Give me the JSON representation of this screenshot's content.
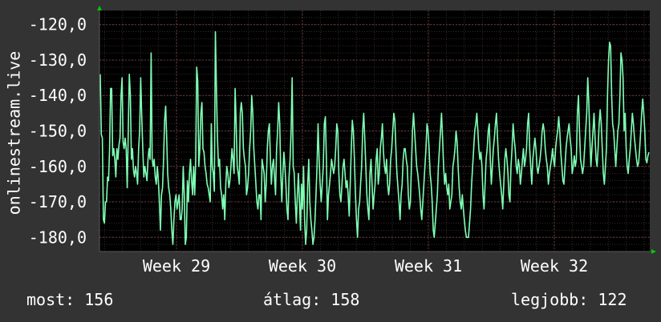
{
  "chart_data": {
    "type": "line",
    "ylabel": "onlinestream.live",
    "ylim": [
      -184,
      -116
    ],
    "y_ticks": [
      -120,
      -130,
      -140,
      -150,
      -160,
      -170,
      -180
    ],
    "y_tick_labels": [
      "-120,0",
      "-130,0",
      "-140,0",
      "-150,0",
      "-160,0",
      "-170,0",
      "-180,0"
    ],
    "x_tick_labels": [
      "Week 29",
      "Week 30",
      "Week 31",
      "Week 32"
    ],
    "grid": true,
    "series": [
      {
        "color": "#7fffb4",
        "values": [
          -134,
          -151,
          -152,
          -175,
          -176,
          -170,
          -170,
          -163,
          -164,
          -155,
          -138,
          -138,
          -157,
          -155,
          -158,
          -163,
          -155,
          -158,
          -154,
          -152,
          -140,
          -135,
          -153,
          -155,
          -152,
          -155,
          -166,
          -150,
          -134,
          -140,
          -158,
          -155,
          -161,
          -163,
          -160,
          -162,
          -165,
          -155,
          -150,
          -135,
          -146,
          -155,
          -163,
          -160,
          -162,
          -164,
          -158,
          -155,
          -158,
          -128,
          -158,
          -160,
          -158,
          -163,
          -165,
          -160,
          -164,
          -170,
          -178,
          -168,
          -166,
          -158,
          -147,
          -143,
          -152,
          -162,
          -166,
          -168,
          -172,
          -178,
          -182,
          -175,
          -170,
          -168,
          -172,
          -170,
          -168,
          -175,
          -175,
          -172,
          -160,
          -168,
          -182,
          -180,
          -164,
          -170,
          -162,
          -158,
          -164,
          -168,
          -160,
          -168,
          -158,
          -132,
          -136,
          -160,
          -155,
          -145,
          -142,
          -155,
          -156,
          -160,
          -162,
          -165,
          -166,
          -168,
          -170,
          -148,
          -160,
          -162,
          -167,
          -122,
          -138,
          -152,
          -160,
          -158,
          -166,
          -168,
          -172,
          -168,
          -175,
          -165,
          -160,
          -162,
          -166,
          -164,
          -160,
          -155,
          -158,
          -162,
          -138,
          -148,
          -160,
          -162,
          -165,
          -145,
          -142,
          -145,
          -155,
          -158,
          -160,
          -168,
          -166,
          -162,
          -155,
          -150,
          -140,
          -145,
          -155,
          -160,
          -165,
          -170,
          -172,
          -168,
          -168,
          -175,
          -158,
          -160,
          -162,
          -170,
          -165,
          -155,
          -150,
          -148,
          -158,
          -165,
          -160,
          -158,
          -163,
          -168,
          -155,
          -150,
          -142,
          -148,
          -162,
          -170,
          -162,
          -156,
          -160,
          -165,
          -172,
          -175,
          -163,
          -158,
          -150,
          -135,
          -160,
          -162,
          -170,
          -176,
          -168,
          -162,
          -170,
          -178,
          -165,
          -172,
          -160,
          -175,
          -182,
          -178,
          -165,
          -158,
          -170,
          -175,
          -178,
          -182,
          -180,
          -175,
          -168,
          -160,
          -148,
          -158,
          -165,
          -170,
          -165,
          -160,
          -148,
          -146,
          -158,
          -175,
          -168,
          -165,
          -162,
          -158,
          -160,
          -162,
          -160,
          -155,
          -148,
          -150,
          -162,
          -168,
          -170,
          -165,
          -160,
          -158,
          -162,
          -166,
          -164,
          -168,
          -174,
          -165,
          -155,
          -147,
          -150,
          -158,
          -168,
          -175,
          -180,
          -172,
          -170,
          -165,
          -160,
          -150,
          -145,
          -152,
          -160,
          -168,
          -172,
          -175,
          -162,
          -158,
          -165,
          -172,
          -168,
          -165,
          -158,
          -155,
          -165,
          -162,
          -155,
          -152,
          -148,
          -156,
          -160,
          -162,
          -158,
          -165,
          -168,
          -165,
          -158,
          -155,
          -150,
          -145,
          -147,
          -155,
          -162,
          -166,
          -170,
          -175,
          -168,
          -165,
          -158,
          -155,
          -155,
          -158,
          -160,
          -168,
          -172,
          -170,
          -160,
          -150,
          -145,
          -150,
          -155,
          -160,
          -162,
          -165,
          -168,
          -172,
          -175,
          -170,
          -165,
          -160,
          -155,
          -148,
          -150,
          -155,
          -162,
          -165,
          -170,
          -178,
          -180,
          -176,
          -172,
          -168,
          -160,
          -155,
          -150,
          -145,
          -152,
          -160,
          -165,
          -162,
          -166,
          -168,
          -165,
          -172,
          -170,
          -168,
          -160,
          -158,
          -155,
          -150,
          -153,
          -160,
          -166,
          -170,
          -172,
          -168,
          -172,
          -175,
          -178,
          -180,
          -180,
          -180,
          -176,
          -172,
          -165,
          -160,
          -155,
          -150,
          -148,
          -145,
          -150,
          -155,
          -158,
          -156,
          -160,
          -168,
          -172,
          -165,
          -158,
          -155,
          -150,
          -148,
          -158,
          -165,
          -160,
          -155,
          -152,
          -148,
          -145,
          -152,
          -158,
          -162,
          -165,
          -168,
          -172,
          -165,
          -158,
          -155,
          -158,
          -162,
          -168,
          -170,
          -160,
          -155,
          -148,
          -152,
          -155,
          -160,
          -162,
          -158,
          -160,
          -165,
          -162,
          -158,
          -155,
          -160,
          -158,
          -155,
          -148,
          -145,
          -155,
          -160,
          -165,
          -158,
          -155,
          -152,
          -155,
          -160,
          -162,
          -160,
          -158,
          -155,
          -150,
          -148,
          -150,
          -155,
          -158,
          -160,
          -165,
          -162,
          -160,
          -158,
          -155,
          -158,
          -160,
          -155,
          -152,
          -150,
          -146,
          -150,
          -156,
          -160,
          -164,
          -165,
          -160,
          -155,
          -152,
          -150,
          -148,
          -152,
          -155,
          -162,
          -160,
          -157,
          -160,
          -158,
          -145,
          -140,
          -150,
          -158,
          -160,
          -162,
          -160,
          -155,
          -150,
          -145,
          -135,
          -142,
          -152,
          -160,
          -155,
          -150,
          -145,
          -152,
          -158,
          -160,
          -155,
          -148,
          -144,
          -148,
          -155,
          -162,
          -165,
          -160,
          -155,
          -140,
          -130,
          -125,
          -126,
          -140,
          -148,
          -150,
          -155,
          -160,
          -155,
          -150,
          -148,
          -140,
          -128,
          -130,
          -135,
          -150,
          -145,
          -155,
          -160,
          -162,
          -158,
          -155,
          -150,
          -145,
          -148,
          -152,
          -155,
          -158,
          -160,
          -159,
          -155,
          -150,
          -145,
          -141,
          -145,
          -150,
          -158,
          -159,
          -157,
          -156
        ]
      }
    ]
  },
  "footer": {
    "now": "most: 156",
    "avg": "átlag: 158",
    "best": "legjobb: 122"
  },
  "colors": {
    "background": "#333333",
    "plot_background": "#000000",
    "grid": "#5a3a3a",
    "line": "#7fffb4",
    "axis_arrow": "#00c800",
    "text": "#ffffff"
  }
}
